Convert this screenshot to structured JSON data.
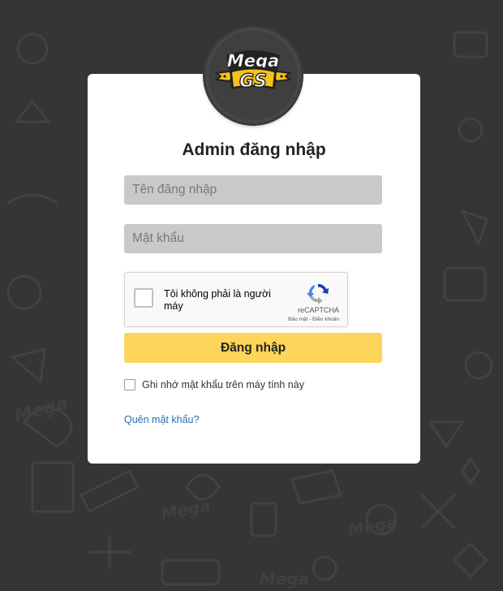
{
  "logo": {
    "line1": "Mega",
    "line2": "GS",
    "icon": "megags-logo"
  },
  "login": {
    "title": "Admin đăng nhập",
    "username_placeholder": "Tên đăng nhập",
    "username_value": "",
    "password_placeholder": "Mật khẩu",
    "password_value": "",
    "submit_label": "Đăng nhập",
    "remember_label": "Ghi nhớ mật khẩu trên máy tính này",
    "remember_checked": false,
    "forgot_label": "Quên mật khẩu?"
  },
  "recaptcha": {
    "label": "Tôi không phải là người máy",
    "brand": "reCAPTCHA",
    "links": "Bảo mật - Điều khoản",
    "checked": false
  },
  "colors": {
    "background": "#353535",
    "card": "#ffffff",
    "input_bg": "#c9c9c9",
    "button": "#fdd55a",
    "link": "#2a6fb0",
    "logo_yellow": "#f7c21a"
  }
}
